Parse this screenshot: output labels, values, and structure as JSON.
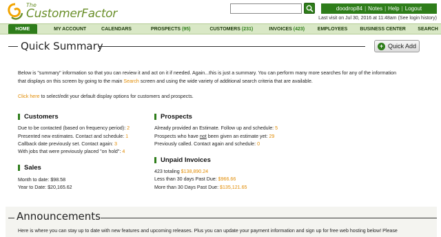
{
  "brand": {
    "the": "The",
    "name": "CustomerFactor"
  },
  "header": {
    "search_placeholder": "",
    "user": "doodrop84",
    "notes": "Notes",
    "help": "Help",
    "logout": "Logout",
    "last_visit": "Last visit on Jul 30, 2016 at 11:48am (See login history)"
  },
  "nav": {
    "home": "HOME",
    "my_account": "MY ACCOUNT",
    "calendars": "CALENDARS",
    "prospects": "PROSPECTS",
    "prospects_count": "(95)",
    "customers": "CUSTOMERS",
    "customers_count": "(231)",
    "invoices": "INVOICES",
    "invoices_count": "(423)",
    "employees": "EMPLOYEES",
    "business_center": "BUSINESS CENTER",
    "search": "SEARCH"
  },
  "quick_summary": {
    "title": "Quick Summary",
    "quick_add": "Quick Add",
    "intro_1": "Below is \"summary\" information so that you can review it and act on it if needed. Again...this is just a summary. You can perform many more searches for any of the information",
    "intro_2a": "that displays on this screen by going to the main ",
    "intro_2_link": "Search",
    "intro_2b": " screen and using the wide variety of additional search criteria that are available.",
    "click_here": "Click here",
    "click_text": " to select/edit your default display options for customers and prospects."
  },
  "customers": {
    "title": "Customers",
    "rows": [
      {
        "label": "Due to be contacted (based on frequency period): ",
        "value": "2"
      },
      {
        "label": "Presented new estimates. Contact and schedule: ",
        "value": "1"
      },
      {
        "label": "Callback date previously set. Contact again: ",
        "value": "3"
      },
      {
        "label": "With jobs that were previously placed \"on hold\": ",
        "value": "4"
      }
    ]
  },
  "prospects": {
    "title": "Prospects",
    "row1_label": "Already provided an Estimate. Follow up and schedule: ",
    "row1_value": "5",
    "row2_a": "Prospects who have ",
    "row2_not": "not",
    "row2_b": " been given an estimate yet: ",
    "row2_value": "29",
    "row3_label": "Previously called. Contact again and schedule: ",
    "row3_value": "0"
  },
  "sales": {
    "title": "Sales",
    "month_to_date": "Month to date: $98.58",
    "year_to_date": "Year to Date: $20,165.62"
  },
  "invoices": {
    "title": "Unpaid Invoices",
    "rows": [
      {
        "label": "423 totaling ",
        "value": "$138,890.24"
      },
      {
        "label": "Less than 30 days Past Due: ",
        "value": "$966.66"
      },
      {
        "label": "More than 30 Days Past Due: ",
        "value": "$135,121.65"
      }
    ]
  },
  "announcements": {
    "title": "Announcements",
    "text": "Here is where you can stay up to date with new features and upcoming releases. Plus you can update your payment information and sign up for free web hosting below! Please"
  },
  "colors": {
    "brand_green": "#2e7d1a",
    "link_orange": "#e08a00",
    "nav_bg": "#d9e8c6"
  }
}
